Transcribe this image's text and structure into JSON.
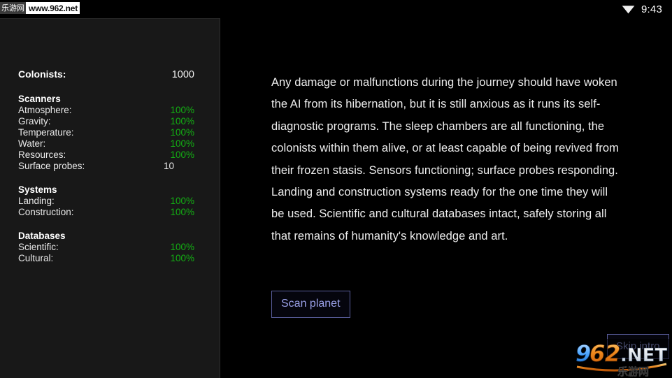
{
  "status_bar": {
    "time": "9:43",
    "wifi_icon": "wifi-signal-icon"
  },
  "watermark_top": {
    "cn_label": "乐游网",
    "url": "www.962.net"
  },
  "watermark_logo": {
    "text": "962.NET",
    "cn_text": "乐游网",
    "accent_color": "#f08a1e",
    "secondary_color": "#4da6ff"
  },
  "colors": {
    "ok_green": "#13b013",
    "button_accent": "#9aa0e8",
    "button_border": "#5b5f9e",
    "panel_bg": "#181818",
    "page_bg": "#000000"
  },
  "stats_panel": {
    "colonists": {
      "label": "Colonists:",
      "value": "1000"
    },
    "sections": [
      {
        "title": "Scanners",
        "rows": [
          {
            "label": "Atmosphere:",
            "value": "100%",
            "state": "green"
          },
          {
            "label": "Gravity:",
            "value": "100%",
            "state": "green"
          },
          {
            "label": "Temperature:",
            "value": "100%",
            "state": "green"
          },
          {
            "label": "Water:",
            "value": "100%",
            "state": "green"
          },
          {
            "label": "Resources:",
            "value": "100%",
            "state": "green"
          },
          {
            "label": "Surface probes:",
            "value": "10",
            "state": "plain"
          }
        ]
      },
      {
        "title": "Systems",
        "rows": [
          {
            "label": "Landing:",
            "value": "100%",
            "state": "green"
          },
          {
            "label": "Construction:",
            "value": "100%",
            "state": "green"
          }
        ]
      },
      {
        "title": "Databases",
        "rows": [
          {
            "label": "Scientific:",
            "value": "100%",
            "state": "green"
          },
          {
            "label": "Cultural:",
            "value": "100%",
            "state": "green"
          }
        ]
      }
    ]
  },
  "main": {
    "narrative": "Any damage or malfunctions during the journey should have woken the AI from its hibernation, but it is still anxious as it runs its self-diagnostic programs. The sleep chambers are all functioning, the colonists within them alive, or at least capable of being revived from their frozen stasis. Sensors functioning; surface probes responding. Landing and construction systems ready for the one time they will be used. Scientific and cultural databases intact, safely storing all that remains of humanity's knowledge and art.",
    "scan_button_label": "Scan planet",
    "skip_button_label": "Skip intro"
  }
}
